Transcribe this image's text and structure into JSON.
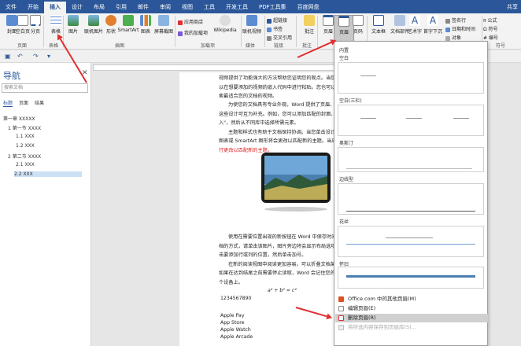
{
  "tabs": [
    "文件",
    "开始",
    "插入",
    "设计",
    "布局",
    "引用",
    "邮件",
    "审阅",
    "视图",
    "工具",
    "开发工具",
    "PDF工具集",
    "百度网盘"
  ],
  "tab_right": "共享",
  "ribbon": {
    "buttons": [
      "封面",
      "空白页",
      "分页",
      "表格",
      "图片",
      "联机图片",
      "形状",
      "SmartArt",
      "图表",
      "屏幕截图",
      "Wikipedia",
      "联机视频",
      "批注",
      "页眉",
      "页码",
      "文本框",
      "文档部件",
      "艺术字",
      "首字下沉"
    ],
    "small": [
      "应用商店",
      "我的加载项",
      "超链接",
      "书签",
      "交叉引用",
      "签名行",
      "日期和时间",
      "对象",
      "公式",
      "符号",
      "编号"
    ],
    "groups": [
      "页面",
      "表格",
      "插图",
      "加载项",
      "媒体",
      "链接",
      "批注",
      "符号"
    ]
  },
  "nav": {
    "title": "导航",
    "search_placeholder": "搜索文档",
    "tabs": [
      "标题",
      "页面",
      "结果"
    ],
    "tree": [
      "第一章 XXXXX",
      "1 第一节 XXXX",
      "1.1 XXX",
      "1.2 XXX",
      "2 第二节 XXXX",
      "2.1 XXX",
      "2.2 XXX"
    ]
  },
  "doc": {
    "lines": [
      "视频提供了功能强大的方法帮助您证明您的观点。当您单击联机视频时，可",
      "以在想要添加的视频的嵌入代码中进行粘贴。您也可以键入一个关键字以联机搜",
      "索最适合您的文档的视频。",
      "为使您的文档具有专业外观，Word 提供了页眉、页脚、封面和文本框设计，",
      "这些设计可互为补充。例如，您可以添加匹配的封面、页眉和提要栏。单击\"插",
      "入\"，然后从不同库中选择所需元素。",
      "主题和样式也有助于文档保持协调。当您单击设计并选择新的主题时，图片、",
      "图表或 SmartArt 图形将会更改以匹配新的主题。当应用样式时，您的标题会进",
      "行更改以匹配新的主题。",
      "使用在需要位置出现的新按钮在 Word 中保存时间。若要更改图片适应文",
      "档的方式，请单击该图片，图片旁边将会显示布局选项按钮。当处理表格时，单",
      "击要添加行或列的位置，然后单击加号。",
      "在新的阅读视图中阅读更加容易。可以折叠文档某些部分并关注所需文本。",
      "如果在达到结尾之前需要停止读取，Word 会记住您的停止位置 - 即使在另一",
      "个设备上。",
      "a² + b² = c²",
      "1234567890",
      "Apple Pay",
      "App Store",
      "Apple Watch",
      "Apple Arcade"
    ]
  },
  "dropdown": {
    "builtin": "内置",
    "thumbs": [
      "空白",
      "空白(三栏)",
      "奥斯汀",
      "边线型",
      "花丝",
      "怀旧"
    ],
    "menu": [
      "Office.com 中的其他页眉(M)",
      "编辑页眉(E)",
      "删除页眉(R)",
      "将所选内容保存到页眉库(S)..."
    ]
  },
  "colors": {
    "accent": "#2b579a",
    "highlight": "#d0d0d0",
    "annotation_arrow": "#e03030",
    "red_text": "#e02020"
  }
}
